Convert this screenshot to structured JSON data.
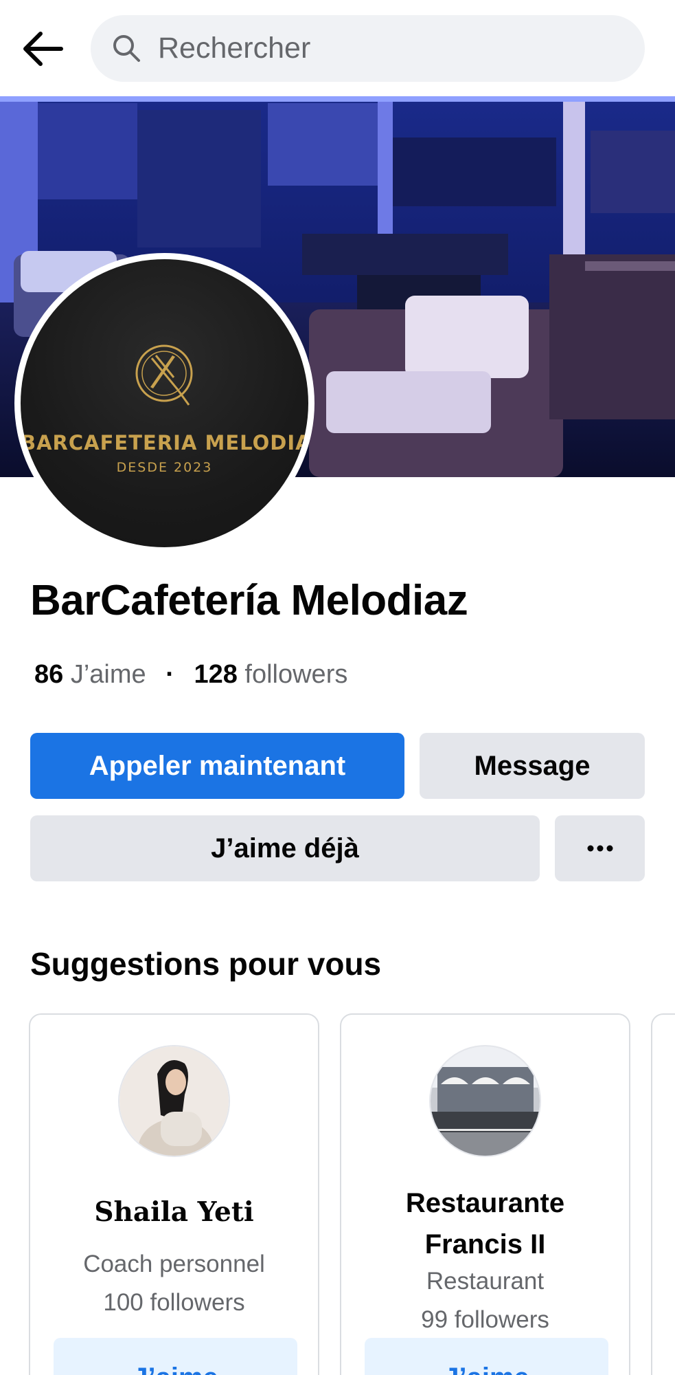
{
  "search": {
    "placeholder": "Rechercher"
  },
  "page": {
    "name": "BarCafetería Melodiaz",
    "logo_title": "BARCAFETERIA MELODIAZ",
    "logo_sub": "DESDE 2023",
    "likes_count": "86",
    "likes_label": "J’aime",
    "followers_count": "128",
    "followers_label": "followers"
  },
  "actions": {
    "call": "Appeler maintenant",
    "message": "Message",
    "liked": "J’aime déjà",
    "more": "•••"
  },
  "suggestions": {
    "title": "Suggestions pour vous",
    "items": [
      {
        "name": "Shaila Yeti",
        "category": "Coach personnel",
        "followers": "100 followers",
        "button": "J’aime"
      },
      {
        "name": "Restaurante Francis II",
        "category": "Restaurant",
        "followers": "99 followers",
        "button": "J’aime"
      }
    ]
  },
  "colors": {
    "accent": "#1b74e4",
    "secondary_button": "#e4e6eb",
    "muted_text": "#65676b",
    "logo_gold": "#c8a14e"
  }
}
